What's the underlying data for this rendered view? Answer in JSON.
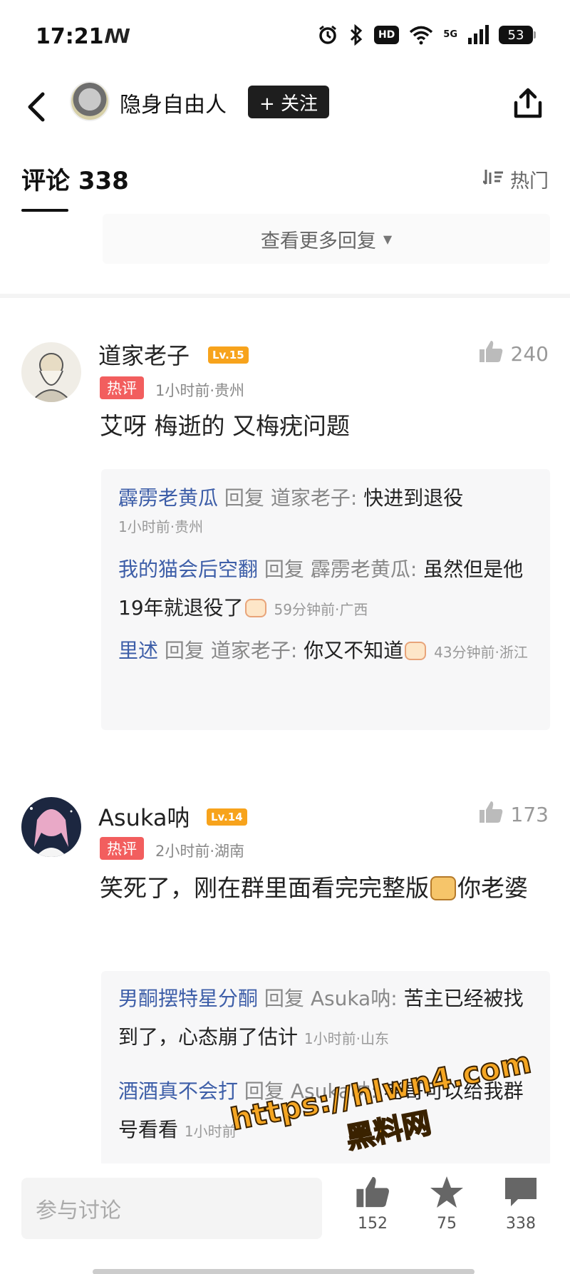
{
  "status_bar": {
    "time": "17:21",
    "left_icon": "ꟿ",
    "icons": [
      "alarm-icon",
      "bluetooth-icon",
      "hd-icon",
      "wifi-icon",
      "5g-icon",
      "signal-icon"
    ],
    "hd": "HD",
    "net": "5G",
    "battery": "53"
  },
  "header": {
    "author": "隐身自由人",
    "follow_label": "+ 关注"
  },
  "tabs": {
    "comments_label": "评论 338",
    "sort_label": "热门"
  },
  "more_replies": "查看更多回复",
  "comments": [
    {
      "name": "道家老子",
      "level": "Lv.15",
      "likes": "240",
      "tag": "热评",
      "meta": "1小时前·贵州",
      "body": "艾呀 梅逝的 又梅疣问题",
      "replies": [
        {
          "name": "霹雳老黄瓜",
          "verb": "回复",
          "target": "道家老子:",
          "text": "快进到退役",
          "meta": "1小时前·贵州"
        },
        {
          "name": "我的猫会后空翻",
          "verb": "回复",
          "target": "霹雳老黄瓜:",
          "text": "虽然但是他19年就退役了",
          "meta": "59分钟前·广西"
        },
        {
          "name": "里述",
          "verb": "回复",
          "target": "道家老子:",
          "text": "你又不知道",
          "meta": "43分钟前·浙江"
        }
      ]
    },
    {
      "name": "Asuka呐",
      "level": "Lv.14",
      "likes": "173",
      "tag": "热评",
      "meta": "2小时前·湖南",
      "body_a": "笑死了，刚在群里面看完完整版",
      "body_b": "你老婆",
      "replies": [
        {
          "name": "男酮摆特星分酮",
          "verb": "回复",
          "target": "Asuka呐:",
          "text": "苦主已经被找到了，心态崩了估计",
          "meta": "1小时前·山东"
        },
        {
          "name": "酒酒真不会打",
          "verb": "回复",
          "target": "Asuka呐:",
          "text": "老哥可以给我群号看看",
          "meta": "1小时前"
        }
      ]
    }
  ],
  "watermark": {
    "url": "https://hlwn4.com",
    "name": "黑料网"
  },
  "bottom_bar": {
    "input_placeholder": "参与讨论",
    "likes": "152",
    "favorites": "75",
    "comments": "338"
  }
}
